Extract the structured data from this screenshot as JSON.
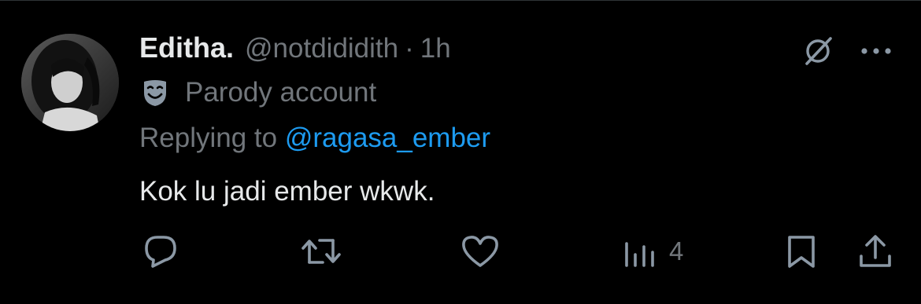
{
  "post": {
    "display_name": "Editha.",
    "handle": "@notdididith",
    "separator": "·",
    "time": "1h",
    "parody_label": "Parody account",
    "replying_prefix": "Replying to ",
    "replying_to": "@ragasa_ember",
    "text": "Kok lu jadi ember wkwk."
  },
  "actions": {
    "views_count": "4"
  },
  "icons": {
    "avatar": "avatar",
    "grok": "grok-icon",
    "more": "more-icon",
    "parody": "theater-mask-icon",
    "reply": "reply-icon",
    "retweet": "retweet-icon",
    "like": "heart-icon",
    "views": "views-icon",
    "bookmark": "bookmark-icon",
    "share": "share-icon"
  },
  "colors": {
    "background": "#000000",
    "primary_text": "#e7e9ea",
    "secondary_text": "#71767b",
    "link": "#1d9bf0",
    "parody_icon": "#8b98a5"
  }
}
